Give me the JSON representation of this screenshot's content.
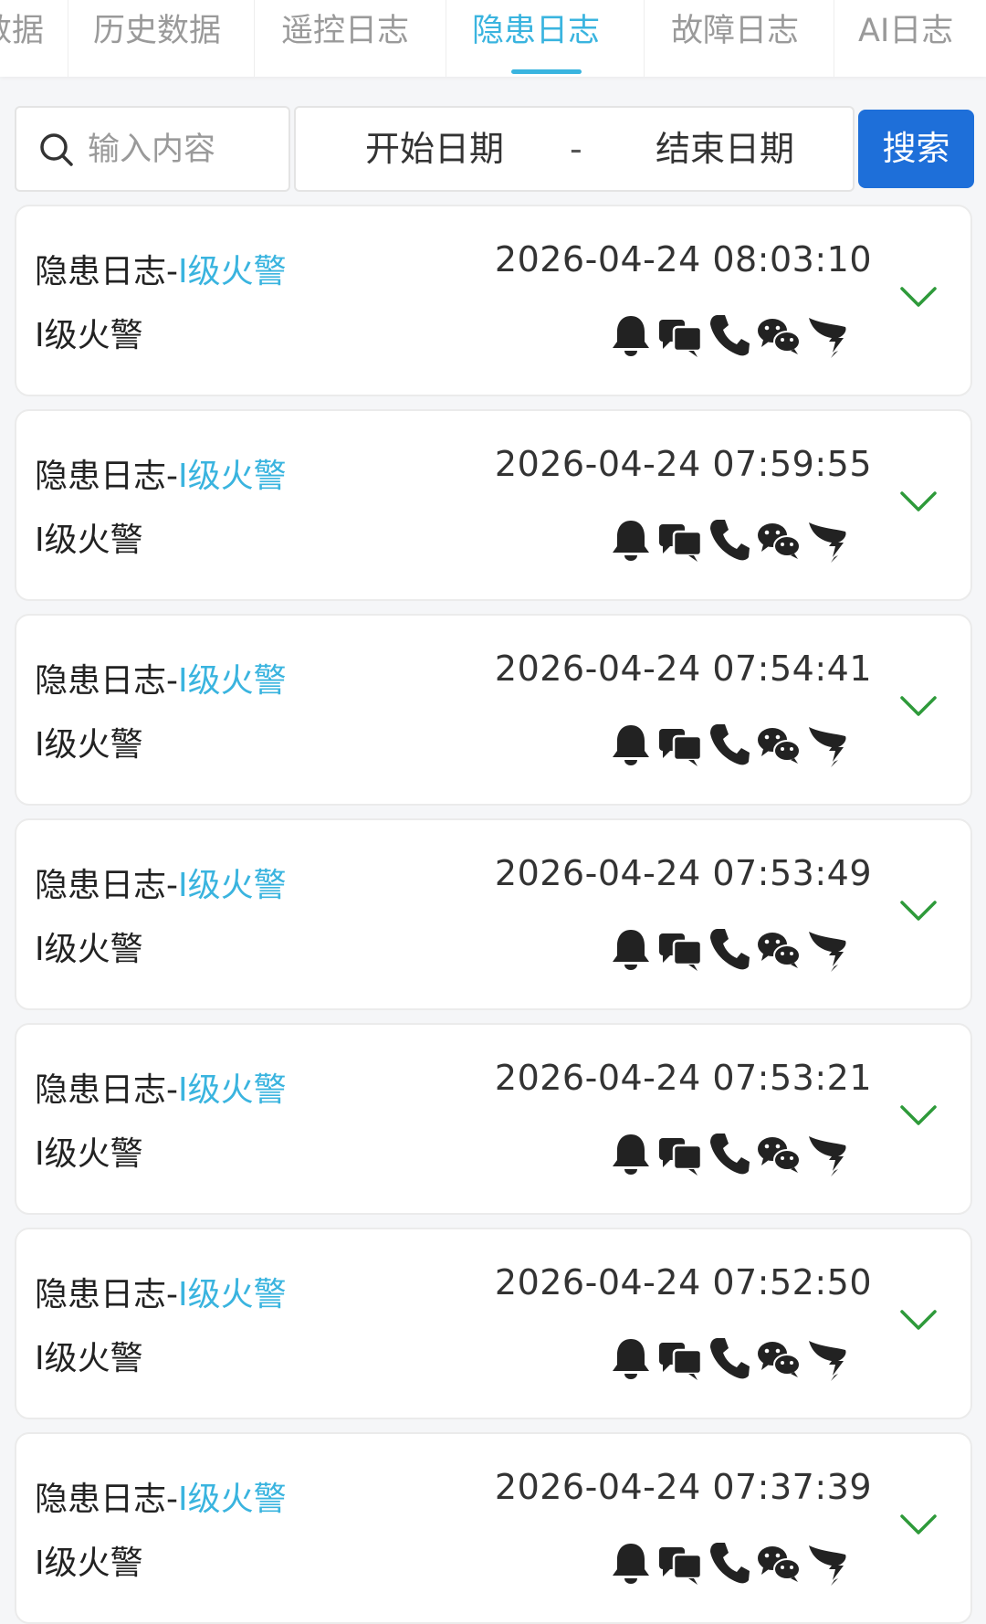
{
  "tabs": [
    {
      "label": "数据"
    },
    {
      "label": "历史数据"
    },
    {
      "label": "遥控日志"
    },
    {
      "label": "隐患日志",
      "active": true
    },
    {
      "label": "故障日志"
    },
    {
      "label": "AI日志"
    }
  ],
  "search": {
    "placeholder": "输入内容",
    "value": ""
  },
  "date_range": {
    "start_placeholder": "开始日期",
    "separator": "-",
    "end_placeholder": "结束日期"
  },
  "search_button": {
    "label": "搜索"
  },
  "colors": {
    "accent": "#3ab4df",
    "button": "#1e6fd9",
    "chevron": "#2e9a3a",
    "icon": "#222222"
  },
  "records": [
    {
      "title_prefix": "隐患日志-",
      "title_level": "I级火警",
      "subtitle": "I级火警",
      "time": "2026-04-24 08:03:10"
    },
    {
      "title_prefix": "隐患日志-",
      "title_level": "I级火警",
      "subtitle": "I级火警",
      "time": "2026-04-24 07:59:55"
    },
    {
      "title_prefix": "隐患日志-",
      "title_level": "I级火警",
      "subtitle": "I级火警",
      "time": "2026-04-24 07:54:41"
    },
    {
      "title_prefix": "隐患日志-",
      "title_level": "I级火警",
      "subtitle": "I级火警",
      "time": "2026-04-24 07:53:49"
    },
    {
      "title_prefix": "隐患日志-",
      "title_level": "I级火警",
      "subtitle": "I级火警",
      "time": "2026-04-24 07:53:21"
    },
    {
      "title_prefix": "隐患日志-",
      "title_level": "I级火警",
      "subtitle": "I级火警",
      "time": "2026-04-24 07:52:50"
    },
    {
      "title_prefix": "隐患日志-",
      "title_level": "I级火警",
      "subtitle": "I级火警",
      "time": "2026-04-24 07:37:39"
    }
  ],
  "notification_icons": [
    "bell-icon",
    "chat-bubbles-icon",
    "phone-icon",
    "wechat-icon",
    "dingtalk-icon"
  ]
}
